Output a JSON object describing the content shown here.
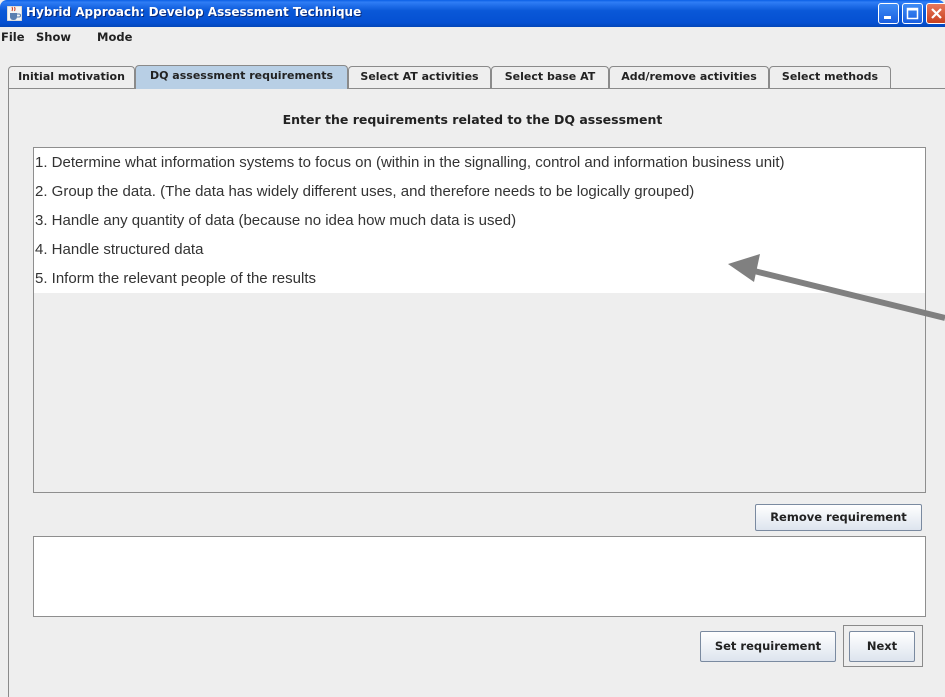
{
  "window": {
    "title": "Hybrid Approach: Develop Assessment Technique",
    "icon": "java-cup-icon",
    "controls": [
      "minimize-icon",
      "maximize-icon",
      "close-icon"
    ]
  },
  "menu": [
    "File",
    "Show",
    "Mode"
  ],
  "tabs": [
    {
      "label": "Initial motivation",
      "selected": false
    },
    {
      "label": "DQ assessment requirements",
      "selected": true
    },
    {
      "label": "Select AT activities",
      "selected": false
    },
    {
      "label": "Select base AT",
      "selected": false
    },
    {
      "label": "Add/remove activities",
      "selected": false
    },
    {
      "label": "Select methods",
      "selected": false
    }
  ],
  "main": {
    "heading": "Enter the requirements related to the DQ assessment",
    "requirements": [
      "1. Determine what information systems to focus on (within in the signalling, control and information business unit)",
      "2. Group the data. (The data has widely different uses, and therefore needs to be logically grouped)",
      "3. Handle any quantity of data (because no idea how much data is used)",
      "4. Handle structured data",
      "5. Inform the relevant people of the results"
    ],
    "remove_button": "Remove requirement",
    "input_value": "",
    "set_button": "Set requirement",
    "next_button": "Next"
  },
  "colors": {
    "titlebar": "#0a58d8",
    "selected_tab": "#b8cfe5",
    "annotation_arrow": "#808080"
  }
}
